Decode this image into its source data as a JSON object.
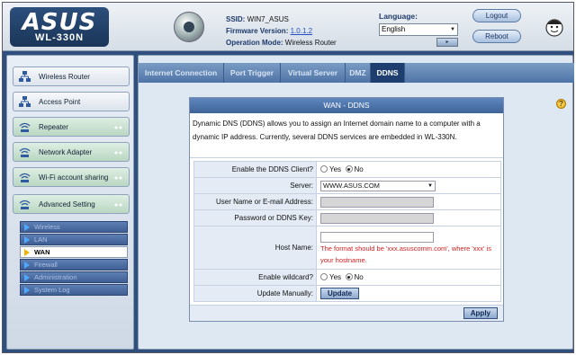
{
  "brand": {
    "logo": "ASUS",
    "model": "WL-330N"
  },
  "info": {
    "ssid_label": "SSID:",
    "ssid": "WIN7_ASUS",
    "firmware_label": "Firmware Version:",
    "firmware": "1.0.1.2",
    "mode_label": "Operation Mode:",
    "mode": "Wireless Router"
  },
  "language": {
    "label": "Language:",
    "selected": "English"
  },
  "header_buttons": {
    "logout": "Logout",
    "reboot": "Reboot"
  },
  "sidebar": {
    "modes": [
      {
        "label": "Wireless Router"
      },
      {
        "label": "Access Point"
      },
      {
        "label": "Repeater"
      },
      {
        "label": "Network Adapter"
      },
      {
        "label": "Wi-Fi account sharing"
      },
      {
        "label": "Advanced Setting"
      }
    ],
    "sub": [
      {
        "label": "Wireless"
      },
      {
        "label": "LAN"
      },
      {
        "label": "WAN"
      },
      {
        "label": "Firewall"
      },
      {
        "label": "Administration"
      },
      {
        "label": "System Log"
      }
    ]
  },
  "tabs": [
    "Internet Connection",
    "Port Trigger",
    "Virtual Server",
    "DMZ",
    "DDNS"
  ],
  "panel": {
    "title": "WAN - DDNS",
    "description": "Dynamic DNS (DDNS) allows you to assign an Internet domain name to a computer with a dynamic IP address. Currently, several DDNS services are embedded in WL-330N.",
    "enable_label": "Enable the DDNS Client?",
    "yes": "Yes",
    "no": "No",
    "server_label": "Server:",
    "server_value": "WWW.ASUS.COM",
    "user_label": "User Name or E-mail Address:",
    "password_label": "Password or DDNS Key:",
    "host_label": "Host Name:",
    "host_hint": "The format should be 'xxx.asuscomm.com', where 'xxx' is your hostname.",
    "wildcard_label": "Enable wildcard?",
    "update_label": "Update Manually:",
    "update_button": "Update",
    "apply_button": "Apply"
  },
  "colors": {
    "accent": "#1d3e6e",
    "warning": "#d32020"
  }
}
